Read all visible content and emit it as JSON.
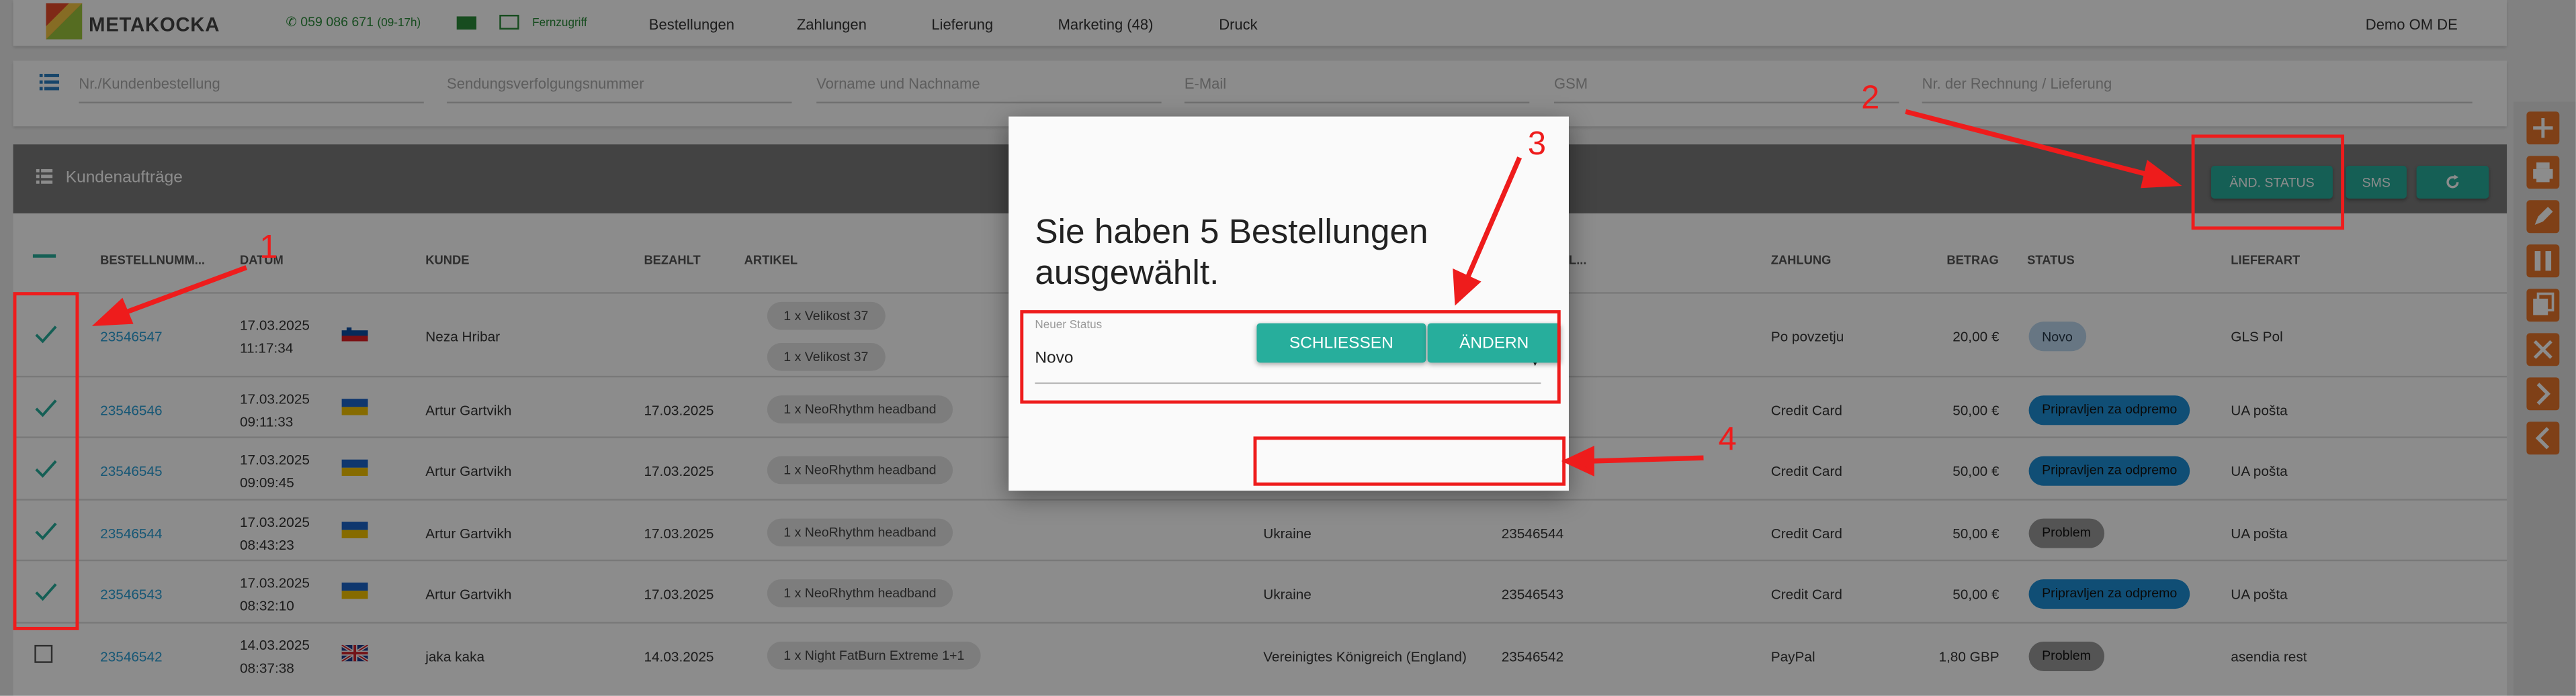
{
  "brand": {
    "name": "METAKOCKA"
  },
  "contact": {
    "phone": "059 086 671",
    "hours": "(09-17h)",
    "remote_label": "Fernzugriff"
  },
  "nav": {
    "items": [
      "Bestellungen",
      "Zahlungen",
      "Lieferung",
      "Marketing (48)",
      "Druck"
    ],
    "user": "Demo OM DE"
  },
  "search": {
    "fields": [
      "Nr./Kundenbestellung",
      "Sendungsverfolgungsnummer",
      "Vorname und Nachname",
      "E-Mail",
      "GSM",
      "Nr. der Rechnung / Lieferung"
    ]
  },
  "panel": {
    "title": "Kundenaufträge",
    "buttons": {
      "change_status": "ÄND. STATUS",
      "sms": "SMS"
    }
  },
  "table": {
    "headers": [
      "BESTELLNUMM...",
      "DATUM",
      "KUNDE",
      "BEZAHLT",
      "ARTIKEL",
      "BESTEL...",
      "ZAHLUNG",
      "BETRAG",
      "STATUS",
      "LIEFERART"
    ],
    "rows": [
      {
        "number": "23546547",
        "date": "17.03.2025",
        "time": "11:17:34",
        "flag": "si",
        "customer": "Neza Hribar",
        "paid": "",
        "items": [
          "1 x Velikost 37",
          "1 x Velikost 37"
        ],
        "country": "",
        "order_ref": "",
        "payment": "Po povzetju",
        "amount": "20,00 €",
        "status": "Novo",
        "delivery": "GLS Pol",
        "checked": true
      },
      {
        "number": "23546546",
        "date": "17.03.2025",
        "time": "09:11:33",
        "flag": "ua",
        "customer": "Artur Gartvikh",
        "paid": "17.03.2025",
        "items": [
          "1 x NeoRhythm headband"
        ],
        "country": "",
        "order_ref": "",
        "payment": "Credit Card",
        "amount": "50,00 €",
        "status": "Pripravljen za odpremo",
        "delivery": "UA pošta",
        "checked": true
      },
      {
        "number": "23546545",
        "date": "17.03.2025",
        "time": "09:09:45",
        "flag": "ua",
        "customer": "Artur Gartvikh",
        "paid": "17.03.2025",
        "items": [
          "1 x NeoRhythm headband"
        ],
        "country": "",
        "order_ref": "",
        "payment": "Credit Card",
        "amount": "50,00 €",
        "status": "Pripravljen za odpremo",
        "delivery": "UA pošta",
        "checked": true
      },
      {
        "number": "23546544",
        "date": "17.03.2025",
        "time": "08:43:23",
        "flag": "ua",
        "customer": "Artur Gartvikh",
        "paid": "17.03.2025",
        "items": [
          "1 x NeoRhythm headband"
        ],
        "country": "Ukraine",
        "order_ref": "23546544",
        "payment": "Credit Card",
        "amount": "50,00 €",
        "status": "Problem",
        "delivery": "UA pošta",
        "checked": true
      },
      {
        "number": "23546543",
        "date": "17.03.2025",
        "time": "08:32:10",
        "flag": "ua",
        "customer": "Artur Gartvikh",
        "paid": "17.03.2025",
        "items": [
          "1 x NeoRhythm headband"
        ],
        "country": "Ukraine",
        "order_ref": "23546543",
        "payment": "Credit Card",
        "amount": "50,00 €",
        "status": "Pripravljen za odpremo",
        "delivery": "UA pošta",
        "checked": true
      },
      {
        "number": "23546542",
        "date": "14.03.2025",
        "time": "08:37:38",
        "flag": "gb",
        "customer": "jaka kaka",
        "paid": "14.03.2025",
        "items": [
          "1 x Night FatBurn Extreme 1+1"
        ],
        "country": "Vereinigtes Königreich (England)",
        "order_ref": "23546542",
        "payment": "PayPal",
        "amount": "1,80 GBP",
        "status": "Problem",
        "delivery": "asendia rest",
        "checked": false
      }
    ]
  },
  "status_colors": {
    "Novo": "#bcd8ee",
    "Pripravljen za odpremo": "#1e8fd6",
    "Problem": "#9a9a9a"
  },
  "modal": {
    "title": "Sie haben 5 Bestellungen ausgewählt.",
    "field_label": "Neuer Status",
    "field_value": "Novo",
    "close_label": "SCHLIESSEN",
    "change_label": "ÄNDERN"
  },
  "annotations": [
    "1",
    "2",
    "3",
    "4"
  ],
  "accent": "#27ae9c",
  "annotation_color": "#ee1c1c"
}
